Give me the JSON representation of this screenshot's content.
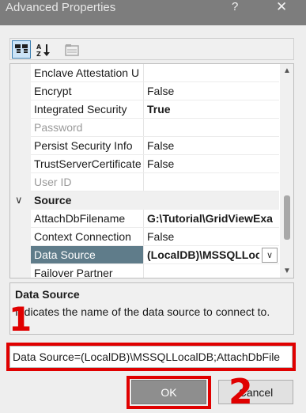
{
  "window": {
    "title": "Advanced Properties",
    "help_label": "?",
    "close_label": "✕"
  },
  "toolbar": {
    "buttons": [
      {
        "name": "categorized",
        "icon": "categorized-view-icon",
        "active": true
      },
      {
        "name": "alphabetical",
        "icon": "alphabetical-sort-icon",
        "active": false
      },
      {
        "name": "property-pages",
        "icon": "property-pages-icon",
        "disabled": true
      }
    ]
  },
  "properties": {
    "rows": [
      {
        "name": "Enclave Attestation U",
        "value": ""
      },
      {
        "name": "Encrypt",
        "value": "False"
      },
      {
        "name": "Integrated Security",
        "value": "True"
      },
      {
        "name": "Password",
        "value": ""
      },
      {
        "name": "Persist Security Info",
        "value": "False"
      },
      {
        "name": "TrustServerCertificate",
        "value": "False"
      },
      {
        "name": "User ID",
        "value": ""
      },
      {
        "category": "Source"
      },
      {
        "name": "AttachDbFilename",
        "value": "G:\\Tutorial\\GridViewExa"
      },
      {
        "name": "Context Connection",
        "value": "False"
      },
      {
        "name": "Data Source",
        "value": "(LocalDB)\\MSSQLLoc"
      },
      {
        "name": "Failover Partner",
        "value": ""
      }
    ],
    "chevron": "∨",
    "dropdown_arrow": "∨"
  },
  "description": {
    "title": "Data Source",
    "text": "Indicates the name of the data source to connect to."
  },
  "connection_string": "Data Source=(LocalDB)\\MSSQLLocalDB;AttachDbFile",
  "buttons": {
    "ok": "OK",
    "cancel": "Cancel"
  },
  "annotations": {
    "marker_1": "1",
    "marker_2": "2",
    "color": "#e00000"
  }
}
